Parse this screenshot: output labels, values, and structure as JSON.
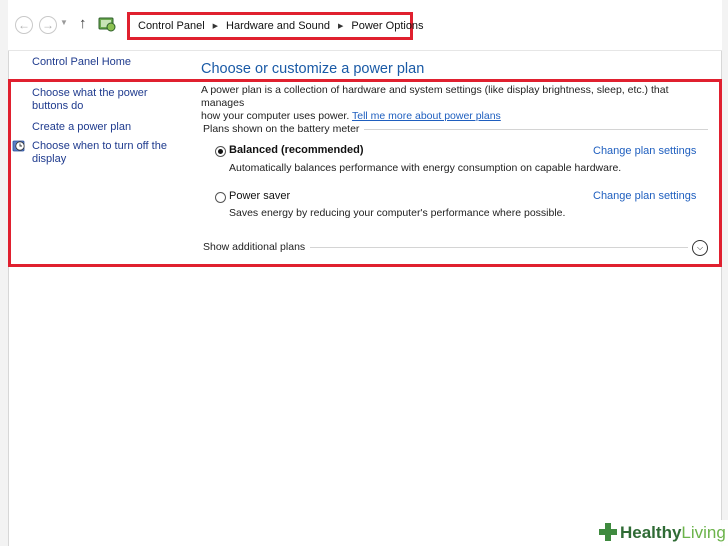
{
  "breadcrumb": [
    "Control Panel",
    "Hardware and Sound",
    "Power Options"
  ],
  "sidebar": {
    "home": "Control Panel Home",
    "items": [
      {
        "label_line1": "Choose what the power",
        "label_line2": "buttons do"
      },
      {
        "label_line1": "Create a power plan",
        "label_line2": ""
      },
      {
        "label_line1": "Choose when to turn off the",
        "label_line2": "display",
        "icon": "clock-icon"
      }
    ]
  },
  "main": {
    "title": "Choose or customize a power plan",
    "description_line1": "A power plan is a collection of hardware and system settings (like display brightness, sleep, etc.) that manages",
    "description_line2": "how your computer uses power.",
    "learn_more": "Tell me more about power plans",
    "group_label": "Plans shown on the battery meter",
    "plans": [
      {
        "name": "Balanced (recommended)",
        "selected": true,
        "description": "Automatically balances performance with energy consumption on capable hardware.",
        "link": "Change plan settings"
      },
      {
        "name": "Power saver",
        "selected": false,
        "description": "Saves energy by reducing your computer's performance where possible.",
        "link": "Change plan settings"
      }
    ],
    "show_additional": "Show additional plans"
  },
  "watermark": {
    "part1": "Healthy",
    "part2": "Living"
  },
  "colors": {
    "highlight": "#e0202f",
    "link": "#1f5fbf",
    "title": "#1a5aa6"
  }
}
